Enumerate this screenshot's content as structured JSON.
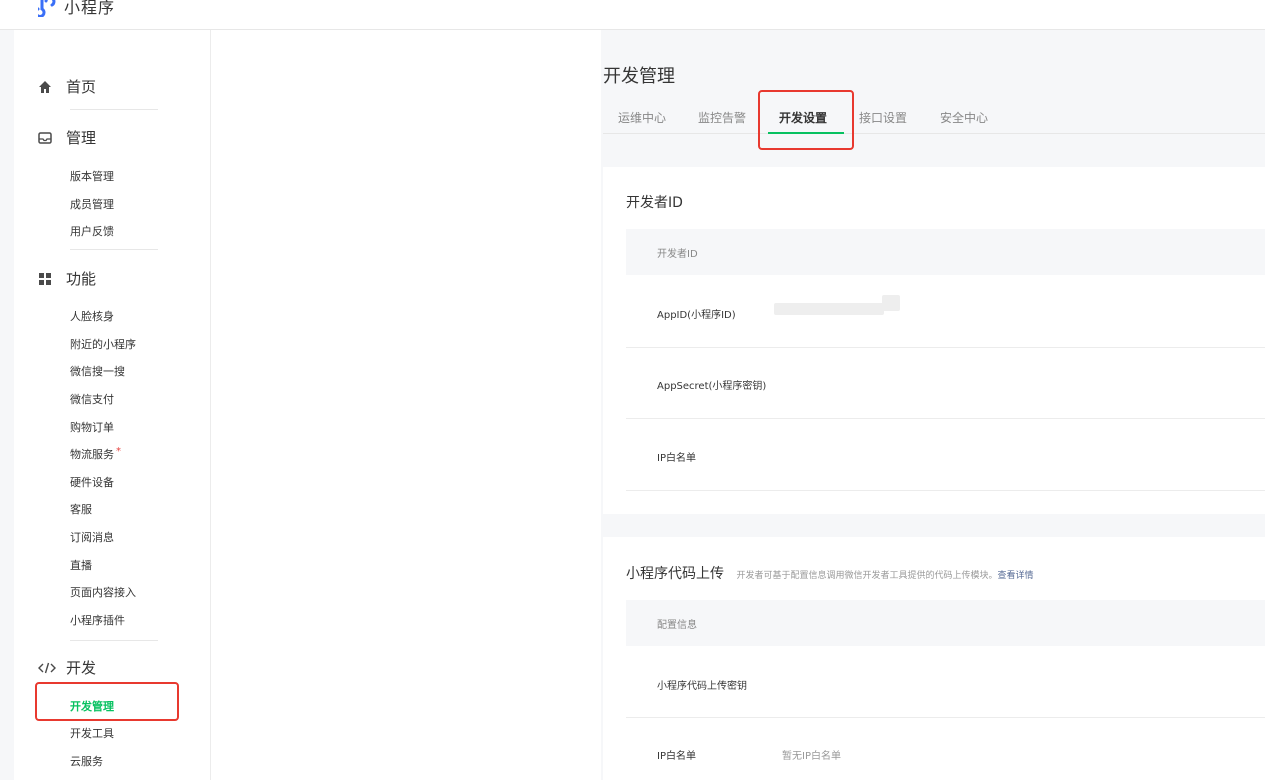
{
  "app": {
    "name": "小程序"
  },
  "sidebar": {
    "sections": [
      {
        "icon": "home-icon",
        "label": "首页",
        "items": []
      },
      {
        "icon": "inbox-icon",
        "label": "管理",
        "items": [
          "版本管理",
          "成员管理",
          "用户反馈"
        ]
      },
      {
        "icon": "grid-icon",
        "label": "功能",
        "items": [
          "人脸核身",
          "附近的小程序",
          "微信搜一搜",
          "微信支付",
          "购物订单",
          "物流服务",
          "硬件设备",
          "客服",
          "订阅消息",
          "直播",
          "页面内容接入",
          "小程序插件"
        ]
      },
      {
        "icon": "code-icon",
        "label": "开发",
        "items": [
          "开发管理",
          "开发工具",
          "云服务"
        ]
      }
    ],
    "new_badge": "*",
    "active_item": "开发管理"
  },
  "page": {
    "title": "开发管理",
    "tabs": [
      "运维中心",
      "监控告警",
      "开发设置",
      "接口设置",
      "安全中心"
    ],
    "active_tab": "开发设置"
  },
  "developer_id_card": {
    "title": "开发者ID",
    "header": "开发者ID",
    "rows": [
      {
        "label": "AppID(小程序ID)",
        "value": ""
      },
      {
        "label": "AppSecret(小程序密钥)",
        "value": ""
      },
      {
        "label": "IP白名单",
        "value": ""
      }
    ]
  },
  "upload_card": {
    "title": "小程序代码上传",
    "description": "开发者可基于配置信息调用微信开发者工具提供的代码上传模块。",
    "link": "查看详情",
    "header": "配置信息",
    "rows": [
      {
        "label": "小程序代码上传密钥",
        "value": ""
      },
      {
        "label": "IP白名单",
        "value": "暂无IP白名单"
      }
    ]
  },
  "colors": {
    "accent": "#07c160",
    "highlight": "#e8392f",
    "link": "#576b95"
  }
}
